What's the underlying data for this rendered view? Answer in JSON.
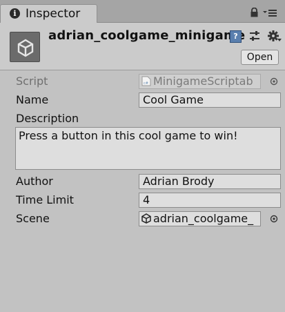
{
  "tab": {
    "label": "Inspector",
    "info_glyph": "i"
  },
  "header": {
    "title": "adrian_coolgame_minigame",
    "open_label": "Open",
    "help_glyph": "?"
  },
  "properties": {
    "script": {
      "label": "Script",
      "value": "MinigameScriptab"
    },
    "name": {
      "label": "Name",
      "value": "Cool Game"
    },
    "description": {
      "label": "Description",
      "value": "Press a button in this cool game to win!"
    },
    "author": {
      "label": "Author",
      "value": "Adrian Brody"
    },
    "time_limit": {
      "label": "Time Limit",
      "value": "4"
    },
    "scene": {
      "label": "Scene",
      "value": "adrian_coolgame_"
    }
  },
  "icons": [
    "info-icon",
    "lock-icon",
    "menu-icon",
    "unity-asset-icon",
    "help-icon",
    "preset-icon",
    "gear-icon",
    "script-file-icon",
    "object-picker-icon",
    "unity-scene-icon"
  ]
}
